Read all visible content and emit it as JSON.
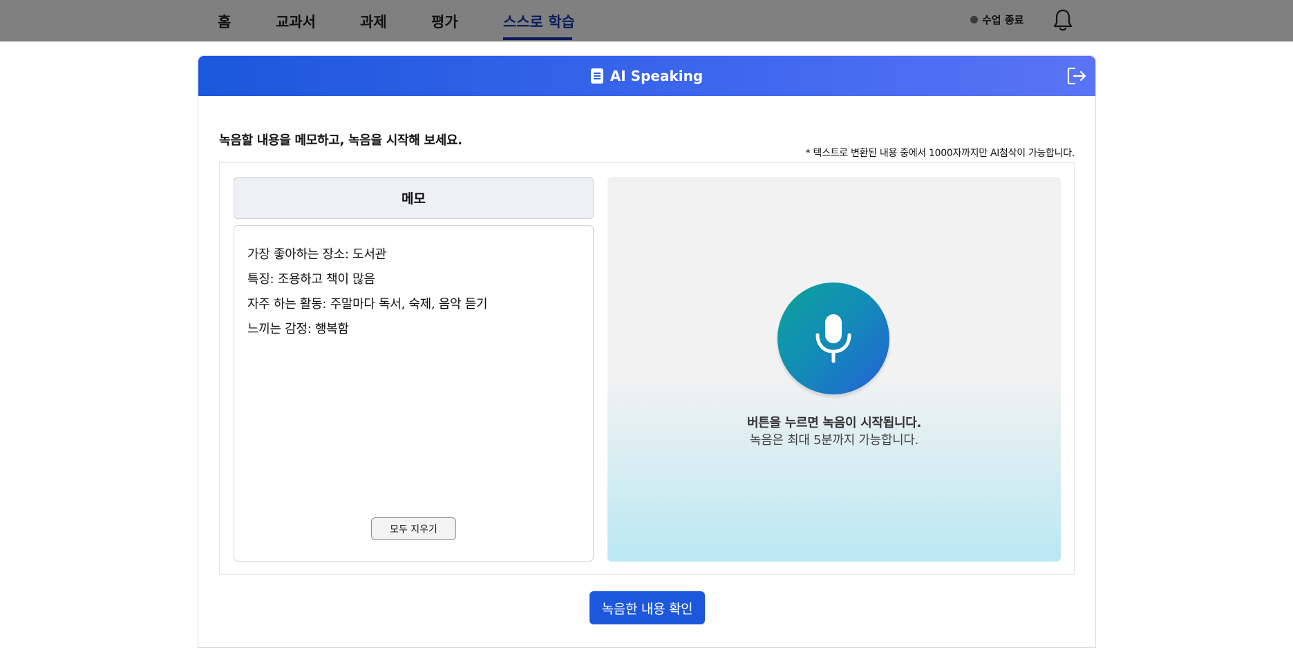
{
  "nav": {
    "items": [
      {
        "label": "홈"
      },
      {
        "label": "교과서"
      },
      {
        "label": "과제"
      },
      {
        "label": "평가"
      },
      {
        "label": "스스로 학습"
      }
    ],
    "active": "스스로 학습",
    "class_end_label": "수업 종료"
  },
  "header": {
    "title": "AI Speaking"
  },
  "main": {
    "instruction": "녹음할 내용을 메모하고, 녹음을 시작해 보세요.",
    "note": "* 텍스트로 변환된 내용 중에서 1000자까지만 AI첨삭이 가능합니다."
  },
  "memo": {
    "title": "메모",
    "lines": [
      "가장 좋아하는 장소: 도서관",
      "특징: 조용하고 책이 많음",
      "자주 하는 활동: 주말마다 독서, 숙제, 음악 듣기",
      "느끼는 감정: 행복함"
    ],
    "clear_label": "모두 지우기"
  },
  "recorder": {
    "line1": "버튼을 누르면 녹음이 시작됩니다.",
    "line2": "녹음은 최대 5분까지 가능합니다."
  },
  "confirm_label": "녹음한 내용 확인",
  "colors": {
    "primary": "#1c57dc",
    "topbar": "#808080",
    "nav_active": "#0b1c5a"
  },
  "icons": [
    "bell-icon",
    "document-icon",
    "exit-icon",
    "microphone-icon"
  ]
}
